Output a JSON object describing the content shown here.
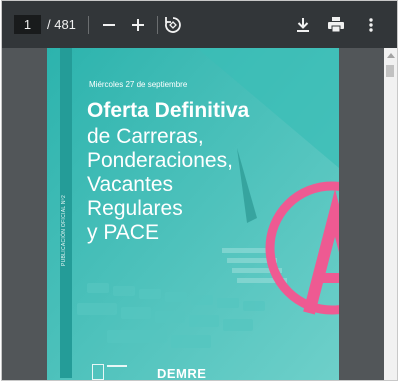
{
  "toolbar": {
    "current_page": "1",
    "page_count_label": "/ 481"
  },
  "document": {
    "date": "Miércoles 27 de septiembre",
    "title": "Oferta Definitiva",
    "subtitle_lines": [
      "de Carreras,",
      "Ponderaciones,",
      "Vacantes",
      "Regulares",
      "y PACE"
    ],
    "vertical_label": "PUBLICACIÓN OFICIAL Nº2",
    "footer_logo": "DEMRE"
  },
  "colors": {
    "toolbar_bg": "#323639",
    "viewer_bg": "#525659",
    "cover_teal": "#2fb6b0",
    "accent_pink": "#ee5a92"
  },
  "icons": {
    "zoom_out": "minus-icon",
    "zoom_in": "plus-icon",
    "rotate": "rotate-icon",
    "download": "download-icon",
    "print": "print-icon",
    "more": "more-vert-icon"
  }
}
